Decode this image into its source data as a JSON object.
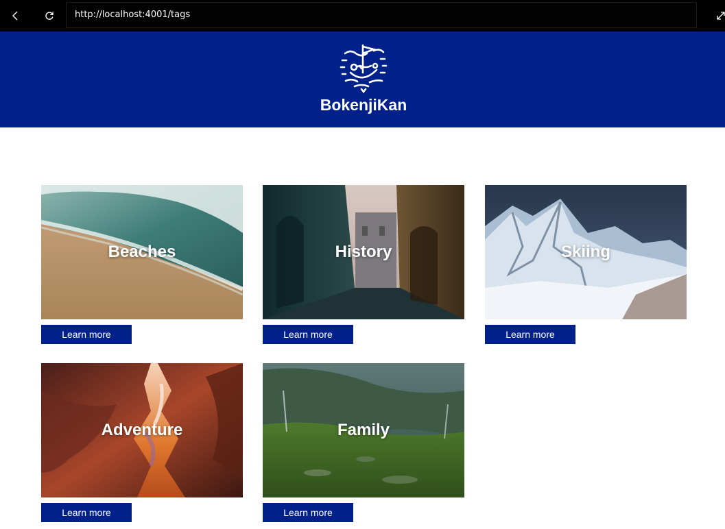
{
  "browser": {
    "url": "http://localhost:4001/tags",
    "icons": [
      "back-arrow-icon",
      "reload-icon",
      "expand-icon"
    ]
  },
  "header": {
    "brand": "BokenjiKan",
    "logo_icon": "bokenjikan-logo-icon",
    "background_color": "#00208a"
  },
  "cards": [
    {
      "title": "Beaches",
      "button": "Learn more"
    },
    {
      "title": "History",
      "button": "Learn more"
    },
    {
      "title": "Skiing",
      "button": "Learn more"
    },
    {
      "title": "Adventure",
      "button": "Learn more"
    },
    {
      "title": "Family",
      "button": "Learn more"
    }
  ],
  "colors": {
    "accent": "#00208a",
    "browser_bar": "#000000",
    "button_text": "#ffffff"
  }
}
